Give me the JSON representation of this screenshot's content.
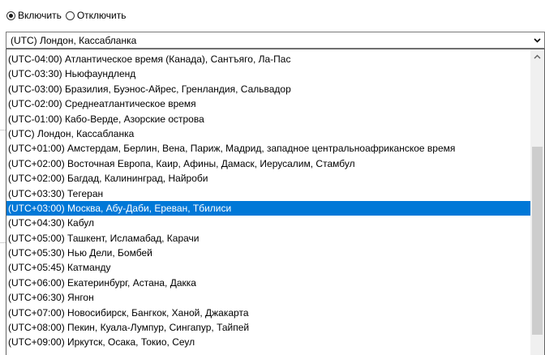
{
  "radio_group": {
    "options": [
      {
        "label": "Включить",
        "checked": true
      },
      {
        "label": "Отключить",
        "checked": false
      }
    ]
  },
  "combo": {
    "selected_text": "(UTC) Лондон, Кассабланка",
    "arrow_icon": "chevron-down-icon"
  },
  "dropdown": {
    "items": [
      {
        "label": "(UTC-04:00) Атлантическое время (Канада), Сантъяго, Ла-Пас",
        "selected": false
      },
      {
        "label": "(UTC-03:30) Ньюфаундленд",
        "selected": false
      },
      {
        "label": "(UTC-03:00) Бразилия, Буэнос-Айрес, Гренландия, Сальвадор",
        "selected": false
      },
      {
        "label": "(UTC-02:00) Среднеатлантическое время",
        "selected": false
      },
      {
        "label": "(UTC-01:00) Кабо-Верде, Азорские острова",
        "selected": false
      },
      {
        "label": "(UTC) Лондон, Кассабланка",
        "selected": false
      },
      {
        "label": "(UTC+01:00) Амстердам, Берлин, Вена, Париж, Мадрид, западное центральноафриканское время",
        "selected": false
      },
      {
        "label": "(UTC+02:00) Восточная Европа, Каир, Афины, Дамаск, Иерусалим, Стамбул",
        "selected": false
      },
      {
        "label": "(UTC+02:00) Багдад, Калининград, Найроби",
        "selected": false
      },
      {
        "label": "(UTC+03:30) Тегеран",
        "selected": false
      },
      {
        "label": "(UTC+03:00) Москва, Абу-Даби, Ереван, Тбилиси",
        "selected": true
      },
      {
        "label": "(UTC+04:30) Кабул",
        "selected": false
      },
      {
        "label": "(UTC+05:00) Ташкент, Исламабад, Карачи",
        "selected": false
      },
      {
        "label": "(UTC+05:30) Нью Дели, Бомбей",
        "selected": false
      },
      {
        "label": "(UTC+05:45) Катманду",
        "selected": false
      },
      {
        "label": "(UTC+06:00) Екатеринбург, Астана, Дакка",
        "selected": false
      },
      {
        "label": "(UTC+06:30) Янгон",
        "selected": false
      },
      {
        "label": "(UTC+07:00) Новосибирск, Бангкок, Ханой, Джакарта",
        "selected": false
      },
      {
        "label": "(UTC+08:00) Пекин, Куала-Лумпур, Сингапур, Тайпей",
        "selected": false
      },
      {
        "label": "(UTC+09:00) Иркутск, Осака, Токио, Сеул",
        "selected": false
      }
    ],
    "scroll_up_icon": "chevron-up-icon"
  },
  "colors": {
    "selection_background": "#0078d7",
    "selection_text": "#ffffff",
    "scrollbar_track": "#f0f0f0",
    "scrollbar_thumb": "#cdcdcd"
  }
}
